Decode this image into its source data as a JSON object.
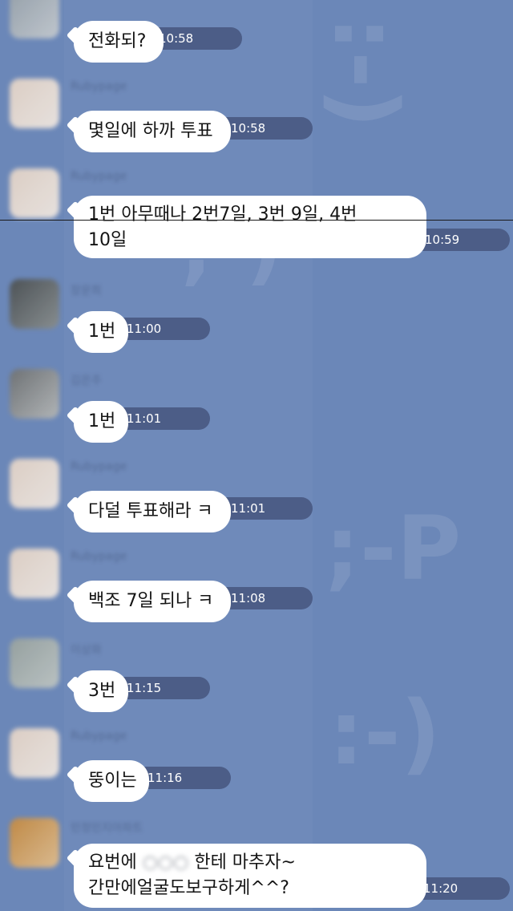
{
  "theme": {
    "background": "#6b87b8",
    "bubble": "#ffffff",
    "time_pill": "#4c5d87"
  },
  "messages": [
    {
      "text": "전화되?",
      "time": "10:58"
    },
    {
      "text": "몇일에 하까 투표",
      "time": "10:58"
    },
    {
      "line1": "1번 아무때나 2번7일, 3번 9일, 4번",
      "line2": "10일",
      "time": "10:59"
    },
    {
      "text": "1번",
      "time": "11:00"
    },
    {
      "text": "1번",
      "time": "11:01"
    },
    {
      "text": "다덜 투표해라 ㅋ",
      "time": "11:01"
    },
    {
      "text": "백조 7일 되나 ㅋ",
      "time": "11:08"
    },
    {
      "text": "3번",
      "time": "11:15"
    },
    {
      "text": "뚱이는",
      "time": "11:16"
    },
    {
      "line1_a": "요번에",
      "line1_blur": "○○○",
      "line1_b": "한테 마추자~",
      "line2": "간만에얼굴도보구하게^^?",
      "time": "11:20"
    }
  ],
  "background_emoticons": [
    ":-)",
    ";-)",
    ";-P",
    ":-)"
  ]
}
